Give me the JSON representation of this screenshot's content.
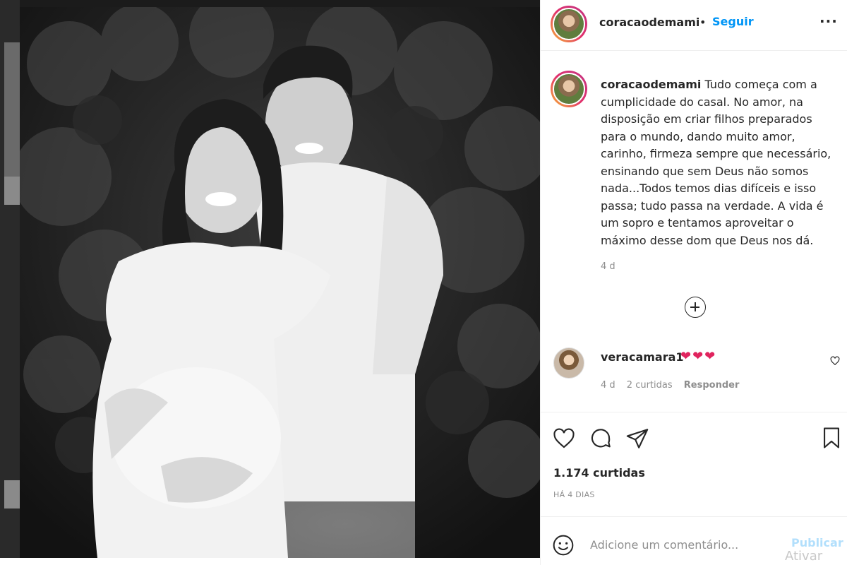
{
  "post": {
    "photo_alt": "",
    "author": {
      "username": "coracaodemami",
      "separator": "•",
      "follow_label": "Seguir",
      "more_icon": "more-horizontal-icon",
      "more_label": "···"
    },
    "caption": {
      "username": "coracaodemami",
      "text": "Tudo começa com a cumplicidade do casal. No amor, na disposição em criar filhos preparados para o mundo, dando muito amor, carinho, firmeza sempre que necessário, ensinando que sem Deus não somos nada...Todos temos dias difíceis e isso passa; tudo passa na verdade. A vida é um sopro e tentamos aproveitar o máximo desse dom que Deus nos dá.",
      "time": "4 d"
    },
    "load_more_icon": "plus-circle-icon",
    "comments": [
      {
        "username": "veracamara1",
        "text": "❤❤❤",
        "time": "4 d",
        "likes": "2 curtidas",
        "reply_label": "Responder",
        "like_icon": "heart-outline-icon"
      }
    ],
    "actions": {
      "like_icon": "heart-outline-icon",
      "comment_icon": "speech-bubble-icon",
      "share_icon": "paper-plane-icon",
      "save_icon": "bookmark-icon"
    },
    "likes_count": "1.174 curtidas",
    "posted": "HÁ 4 DIAS",
    "add_comment": {
      "emoji_icon": "smiley-icon",
      "placeholder": "Adicione um comentário...",
      "publish_label": "Publicar"
    },
    "os_watermark": "Ativar"
  },
  "colors": {
    "accent": "#0095f6",
    "publish_disabled": "#b2dffc",
    "text": "#262626",
    "muted": "#8e8e8e",
    "heart": "#e0245e"
  }
}
